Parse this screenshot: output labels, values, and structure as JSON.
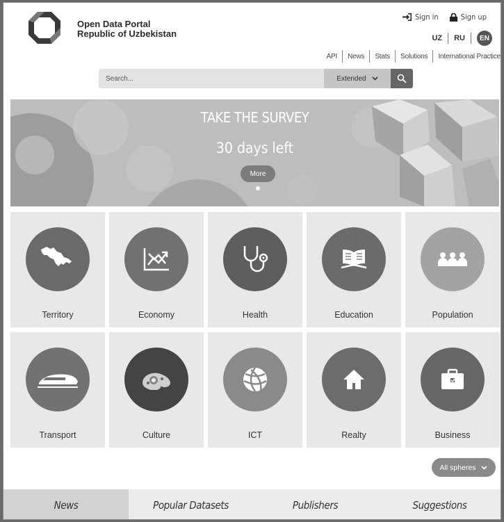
{
  "header": {
    "title_line1": "Open Data Portal",
    "title_line2": "Republic of Uzbekistan",
    "sign_in": "Sign in",
    "sign_up": "Sign up",
    "langs": [
      "UZ",
      "RU",
      "EN"
    ],
    "active_lang": "EN",
    "nav": [
      "API",
      "News",
      "Stats",
      "Solutions",
      "International Practice"
    ]
  },
  "search": {
    "placeholder": "Search...",
    "mode": "Extended"
  },
  "banner": {
    "title": "TAKE THE SURVEY",
    "subtitle": "30 days left",
    "more": "More"
  },
  "spheres": [
    {
      "label": "Territory",
      "icon": "map-uzbekistan-icon",
      "color": "#6a6a6a"
    },
    {
      "label": "Economy",
      "icon": "chart-trend-icon",
      "color": "#717171"
    },
    {
      "label": "Health",
      "icon": "stethoscope-icon",
      "color": "#5e5e5e"
    },
    {
      "label": "Education",
      "icon": "open-book-icon",
      "color": "#6b6b6b"
    },
    {
      "label": "Population",
      "icon": "people-icon",
      "color": "#a3a3a3"
    },
    {
      "label": "Transport",
      "icon": "train-icon",
      "color": "#727272"
    },
    {
      "label": "Culture",
      "icon": "paisley-icon",
      "color": "#444444"
    },
    {
      "label": "ICT",
      "icon": "globe-network-icon",
      "color": "#8a8a8a"
    },
    {
      "label": "Realty",
      "icon": "house-icon",
      "color": "#6c6c6c"
    },
    {
      "label": "Business",
      "icon": "briefcase-icon",
      "color": "#676767"
    }
  ],
  "all_spheres": "All spheres",
  "tabs": [
    "News",
    "Popular Datasets",
    "Publishers",
    "Suggestions"
  ],
  "active_tab": "News"
}
